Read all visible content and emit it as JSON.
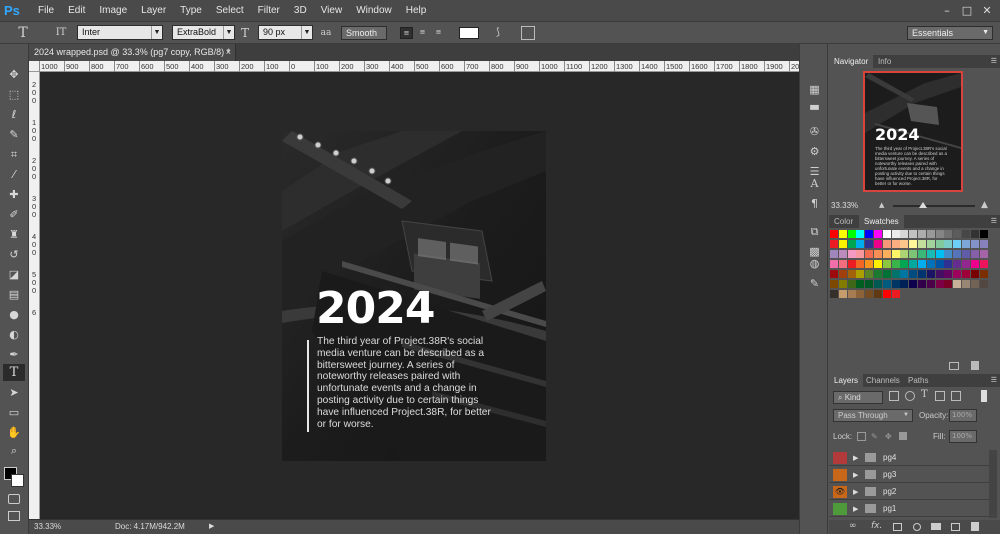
{
  "app": {
    "logo": "Ps"
  },
  "menubar": {
    "items": [
      "File",
      "Edit",
      "Image",
      "Layer",
      "Type",
      "Select",
      "Filter",
      "3D",
      "View",
      "Window",
      "Help"
    ],
    "window_controls": [
      "–",
      "□",
      "✕"
    ]
  },
  "options": {
    "tool_icon": "T",
    "orient_icon": "IT",
    "font_family": "Inter",
    "font_style": "ExtraBold",
    "size_icon": "T",
    "font_size": "90 px",
    "aa_icon": "aa",
    "antialias": "Smooth",
    "workspace": "Essentials",
    "text_color": "#ffffff"
  },
  "document": {
    "tab_title": "2024 wrapped.psd @ 33.3% (pg7 copy, RGB/8) *",
    "tab_close": "×",
    "heading": "2024",
    "body_text": "The third year of Project.38R's social media venture can be described as a bittersweet journey. A series of noteworthy releases paired with unfortunate events and a change in posting activity due to certain things have influenced Project.38R, for better or for worse."
  },
  "ruler": {
    "h_labels": [
      "1000",
      "900",
      "800",
      "700",
      "600",
      "500",
      "400",
      "300",
      "200",
      "100",
      "0",
      "100",
      "200",
      "300",
      "400",
      "500",
      "600",
      "700",
      "800",
      "900",
      "1000",
      "1100",
      "1200",
      "1300",
      "1400",
      "1500",
      "1600",
      "1700",
      "1800",
      "1900",
      "2000"
    ],
    "v_labels": [
      "2",
      "0",
      "0",
      "1",
      "0",
      "0",
      "2",
      "0",
      "0",
      "3",
      "0",
      "0",
      "4",
      "0",
      "0",
      "5",
      "0",
      "0",
      "6"
    ]
  },
  "status": {
    "zoom": "33.33%",
    "doc_size": "Doc: 4.17M/942.2M"
  },
  "navigator": {
    "tabs": [
      "Navigator",
      "Info"
    ],
    "zoom": "33.33%",
    "thumb_heading": "2024",
    "thumb_text": "The third year of Project.38R's social media venture can be described as a bittersweet journey. A series of noteworthy releases paired with unfortunate events and a change in posting activity due to certain things have influenced Project.38R, for better or for worse."
  },
  "swatches_panel": {
    "tabs": [
      "Color",
      "Swatches"
    ]
  },
  "layers_panel": {
    "tabs": [
      "Layers",
      "Channels",
      "Paths"
    ],
    "filter_kind": "Kind",
    "blend_mode": "Pass Through",
    "opacity_label": "Opacity:",
    "opacity_value": "100%",
    "lock_label": "Lock:",
    "fill_label": "Fill:",
    "fill_value": "100%",
    "layers": [
      {
        "name": "pg4",
        "color": "#b33a3a",
        "visible": false
      },
      {
        "name": "pg3",
        "color": "#c7671a",
        "visible": false
      },
      {
        "name": "pg2",
        "color": "#c7671a",
        "visible": true
      },
      {
        "name": "pg1",
        "color": "#4f9a3a",
        "visible": false
      }
    ],
    "footer_icons": [
      "link-icon",
      "fx-icon",
      "mask-icon",
      "adjustment-icon",
      "group-icon",
      "new-layer-icon",
      "trash-icon"
    ]
  },
  "icons": {
    "tools": [
      "move-icon",
      "marquee-icon",
      "lasso-icon",
      "quick-select-icon",
      "crop-icon",
      "eyedropper-icon",
      "healing-icon",
      "brush-icon",
      "clone-stamp-icon",
      "history-brush-icon",
      "eraser-icon",
      "gradient-icon",
      "blur-icon",
      "dodge-icon",
      "pen-icon",
      "type-icon",
      "path-select-icon",
      "rectangle-icon",
      "hand-icon",
      "zoom-icon"
    ]
  }
}
